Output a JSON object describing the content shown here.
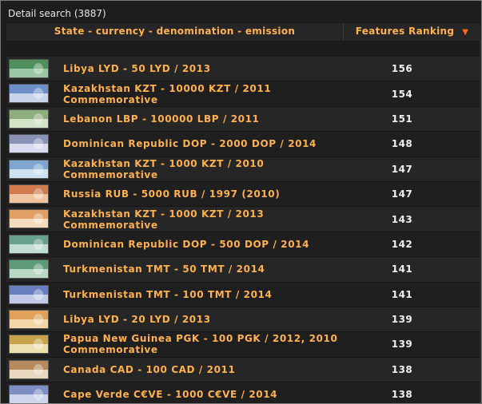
{
  "panel": {
    "title": "Detail search (3887)"
  },
  "header": {
    "col_name": "State - currency - denomination - emission",
    "col_rank": "Features Ranking",
    "sort_indicator": "▼"
  },
  "rows": [
    {
      "line1": "Libya LYD - 50 LYD / 2013",
      "line2": "",
      "rank": "156",
      "thumb": [
        "#4f8f5e",
        "#9cc7a6"
      ]
    },
    {
      "line1": "Kazakhstan KZT - 10000 KZT / 2011",
      "line2": "Commemorative",
      "rank": "154",
      "thumb": [
        "#6f8fc9",
        "#c9d3ea"
      ]
    },
    {
      "line1": "Lebanon LBP - 100000 LBP / 2011",
      "line2": "",
      "rank": "151",
      "thumb": [
        "#8fae7e",
        "#d4e2c8"
      ]
    },
    {
      "line1": "Dominican Republic DOP - 2000 DOP / 2014",
      "line2": "",
      "rank": "148",
      "thumb": [
        "#8a92b8",
        "#d9dcee"
      ]
    },
    {
      "line1": "Kazakhstan KZT - 1000 KZT / 2010",
      "line2": "Commemorative",
      "rank": "147",
      "thumb": [
        "#7fa6cf",
        "#cfe0f0"
      ]
    },
    {
      "line1": "Russia RUB - 5000 RUB / 1997 (2010)",
      "line2": "",
      "rank": "147",
      "thumb": [
        "#d07a4e",
        "#eec39f"
      ]
    },
    {
      "line1": "Kazakhstan KZT - 1000 KZT / 2013",
      "line2": "Commemorative",
      "rank": "143",
      "thumb": [
        "#e0a066",
        "#f5dcc0"
      ]
    },
    {
      "line1": "Dominican Republic DOP - 500 DOP / 2014",
      "line2": "",
      "rank": "142",
      "thumb": [
        "#6aa08e",
        "#c2ddd2"
      ]
    },
    {
      "line1": "Turkmenistan TMT - 50 TMT / 2014",
      "line2": "",
      "rank": "141",
      "thumb": [
        "#5f9a7a",
        "#b9d8c5"
      ]
    },
    {
      "line1": "Turkmenistan TMT - 100 TMT / 2014",
      "line2": "",
      "rank": "141",
      "thumb": [
        "#6a7fbf",
        "#c3cbe8"
      ]
    },
    {
      "line1": "Libya LYD - 20 LYD / 2013",
      "line2": "",
      "rank": "139",
      "thumb": [
        "#e0a15a",
        "#f3d6a8"
      ]
    },
    {
      "line1": "Papua New Guinea PGK - 100 PGK / 2012, 2010",
      "line2": "Commemorative",
      "rank": "139",
      "thumb": [
        "#c7a24a",
        "#ece0b0"
      ]
    },
    {
      "line1": "Canada CAD - 100 CAD / 2011",
      "line2": "",
      "rank": "138",
      "thumb": [
        "#b68a5c",
        "#e8d6bf"
      ]
    },
    {
      "line1": "Cape Verde C€VE - 1000 C€VE / 2014",
      "line2": "",
      "rank": "138",
      "thumb": [
        "#7e8ec2",
        "#cdd4ec"
      ]
    }
  ]
}
